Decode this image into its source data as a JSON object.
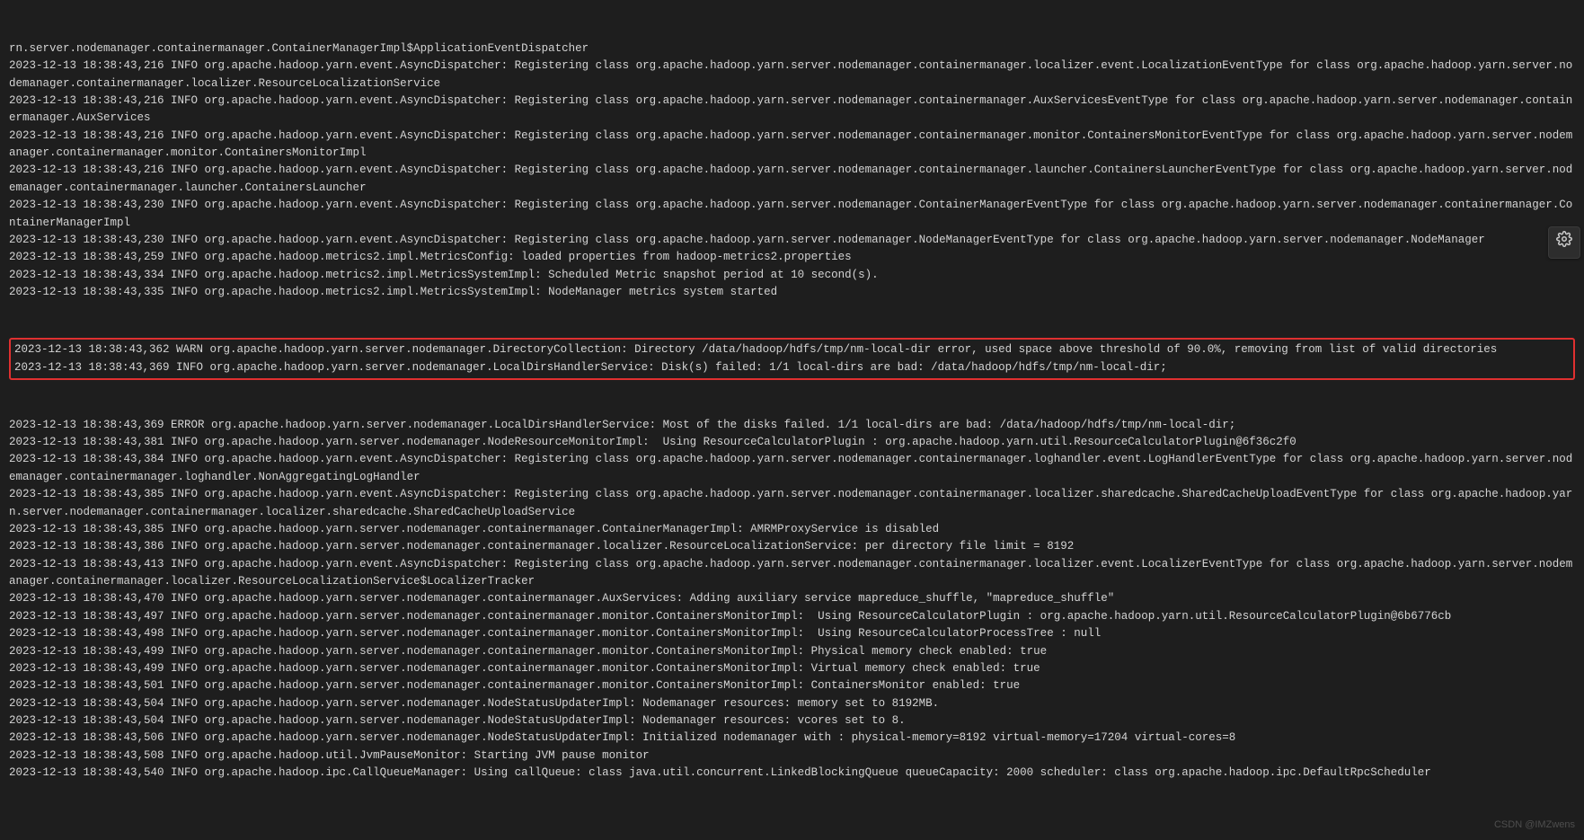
{
  "watermark": "CSDN @IMZwens",
  "log_before": [
    "rn.server.nodemanager.containermanager.ContainerManagerImpl$ApplicationEventDispatcher",
    "2023-12-13 18:38:43,216 INFO org.apache.hadoop.yarn.event.AsyncDispatcher: Registering class org.apache.hadoop.yarn.server.nodemanager.containermanager.localizer.event.LocalizationEventType for class org.apache.hadoop.yarn.server.nodemanager.containermanager.localizer.ResourceLocalizationService",
    "2023-12-13 18:38:43,216 INFO org.apache.hadoop.yarn.event.AsyncDispatcher: Registering class org.apache.hadoop.yarn.server.nodemanager.containermanager.AuxServicesEventType for class org.apache.hadoop.yarn.server.nodemanager.containermanager.AuxServices",
    "2023-12-13 18:38:43,216 INFO org.apache.hadoop.yarn.event.AsyncDispatcher: Registering class org.apache.hadoop.yarn.server.nodemanager.containermanager.monitor.ContainersMonitorEventType for class org.apache.hadoop.yarn.server.nodemanager.containermanager.monitor.ContainersMonitorImpl",
    "2023-12-13 18:38:43,216 INFO org.apache.hadoop.yarn.event.AsyncDispatcher: Registering class org.apache.hadoop.yarn.server.nodemanager.containermanager.launcher.ContainersLauncherEventType for class org.apache.hadoop.yarn.server.nodemanager.containermanager.launcher.ContainersLauncher",
    "2023-12-13 18:38:43,230 INFO org.apache.hadoop.yarn.event.AsyncDispatcher: Registering class org.apache.hadoop.yarn.server.nodemanager.ContainerManagerEventType for class org.apache.hadoop.yarn.server.nodemanager.containermanager.ContainerManagerImpl",
    "2023-12-13 18:38:43,230 INFO org.apache.hadoop.yarn.event.AsyncDispatcher: Registering class org.apache.hadoop.yarn.server.nodemanager.NodeManagerEventType for class org.apache.hadoop.yarn.server.nodemanager.NodeManager",
    "2023-12-13 18:38:43,259 INFO org.apache.hadoop.metrics2.impl.MetricsConfig: loaded properties from hadoop-metrics2.properties",
    "2023-12-13 18:38:43,334 INFO org.apache.hadoop.metrics2.impl.MetricsSystemImpl: Scheduled Metric snapshot period at 10 second(s).",
    "2023-12-13 18:38:43,335 INFO org.apache.hadoop.metrics2.impl.MetricsSystemImpl: NodeManager metrics system started"
  ],
  "log_highlight": [
    "2023-12-13 18:38:43,362 WARN org.apache.hadoop.yarn.server.nodemanager.DirectoryCollection: Directory /data/hadoop/hdfs/tmp/nm-local-dir error, used space above threshold of 90.0%, removing from list of valid directories",
    "2023-12-13 18:38:43,369 INFO org.apache.hadoop.yarn.server.nodemanager.LocalDirsHandlerService: Disk(s) failed: 1/1 local-dirs are bad: /data/hadoop/hdfs/tmp/nm-local-dir;"
  ],
  "log_after": [
    "2023-12-13 18:38:43,369 ERROR org.apache.hadoop.yarn.server.nodemanager.LocalDirsHandlerService: Most of the disks failed. 1/1 local-dirs are bad: /data/hadoop/hdfs/tmp/nm-local-dir;",
    "2023-12-13 18:38:43,381 INFO org.apache.hadoop.yarn.server.nodemanager.NodeResourceMonitorImpl:  Using ResourceCalculatorPlugin : org.apache.hadoop.yarn.util.ResourceCalculatorPlugin@6f36c2f0",
    "2023-12-13 18:38:43,384 INFO org.apache.hadoop.yarn.event.AsyncDispatcher: Registering class org.apache.hadoop.yarn.server.nodemanager.containermanager.loghandler.event.LogHandlerEventType for class org.apache.hadoop.yarn.server.nodemanager.containermanager.loghandler.NonAggregatingLogHandler",
    "2023-12-13 18:38:43,385 INFO org.apache.hadoop.yarn.event.AsyncDispatcher: Registering class org.apache.hadoop.yarn.server.nodemanager.containermanager.localizer.sharedcache.SharedCacheUploadEventType for class org.apache.hadoop.yarn.server.nodemanager.containermanager.localizer.sharedcache.SharedCacheUploadService",
    "2023-12-13 18:38:43,385 INFO org.apache.hadoop.yarn.server.nodemanager.containermanager.ContainerManagerImpl: AMRMProxyService is disabled",
    "2023-12-13 18:38:43,386 INFO org.apache.hadoop.yarn.server.nodemanager.containermanager.localizer.ResourceLocalizationService: per directory file limit = 8192",
    "2023-12-13 18:38:43,413 INFO org.apache.hadoop.yarn.event.AsyncDispatcher: Registering class org.apache.hadoop.yarn.server.nodemanager.containermanager.localizer.event.LocalizerEventType for class org.apache.hadoop.yarn.server.nodemanager.containermanager.localizer.ResourceLocalizationService$LocalizerTracker",
    "2023-12-13 18:38:43,470 INFO org.apache.hadoop.yarn.server.nodemanager.containermanager.AuxServices: Adding auxiliary service mapreduce_shuffle, \"mapreduce_shuffle\"",
    "2023-12-13 18:38:43,497 INFO org.apache.hadoop.yarn.server.nodemanager.containermanager.monitor.ContainersMonitorImpl:  Using ResourceCalculatorPlugin : org.apache.hadoop.yarn.util.ResourceCalculatorPlugin@6b6776cb",
    "2023-12-13 18:38:43,498 INFO org.apache.hadoop.yarn.server.nodemanager.containermanager.monitor.ContainersMonitorImpl:  Using ResourceCalculatorProcessTree : null",
    "2023-12-13 18:38:43,499 INFO org.apache.hadoop.yarn.server.nodemanager.containermanager.monitor.ContainersMonitorImpl: Physical memory check enabled: true",
    "2023-12-13 18:38:43,499 INFO org.apache.hadoop.yarn.server.nodemanager.containermanager.monitor.ContainersMonitorImpl: Virtual memory check enabled: true",
    "2023-12-13 18:38:43,501 INFO org.apache.hadoop.yarn.server.nodemanager.containermanager.monitor.ContainersMonitorImpl: ContainersMonitor enabled: true",
    "2023-12-13 18:38:43,504 INFO org.apache.hadoop.yarn.server.nodemanager.NodeStatusUpdaterImpl: Nodemanager resources: memory set to 8192MB.",
    "2023-12-13 18:38:43,504 INFO org.apache.hadoop.yarn.server.nodemanager.NodeStatusUpdaterImpl: Nodemanager resources: vcores set to 8.",
    "2023-12-13 18:38:43,506 INFO org.apache.hadoop.yarn.server.nodemanager.NodeStatusUpdaterImpl: Initialized nodemanager with : physical-memory=8192 virtual-memory=17204 virtual-cores=8",
    "2023-12-13 18:38:43,508 INFO org.apache.hadoop.util.JvmPauseMonitor: Starting JVM pause monitor",
    "2023-12-13 18:38:43,540 INFO org.apache.hadoop.ipc.CallQueueManager: Using callQueue: class java.util.concurrent.LinkedBlockingQueue queueCapacity: 2000 scheduler: class org.apache.hadoop.ipc.DefaultRpcScheduler"
  ]
}
